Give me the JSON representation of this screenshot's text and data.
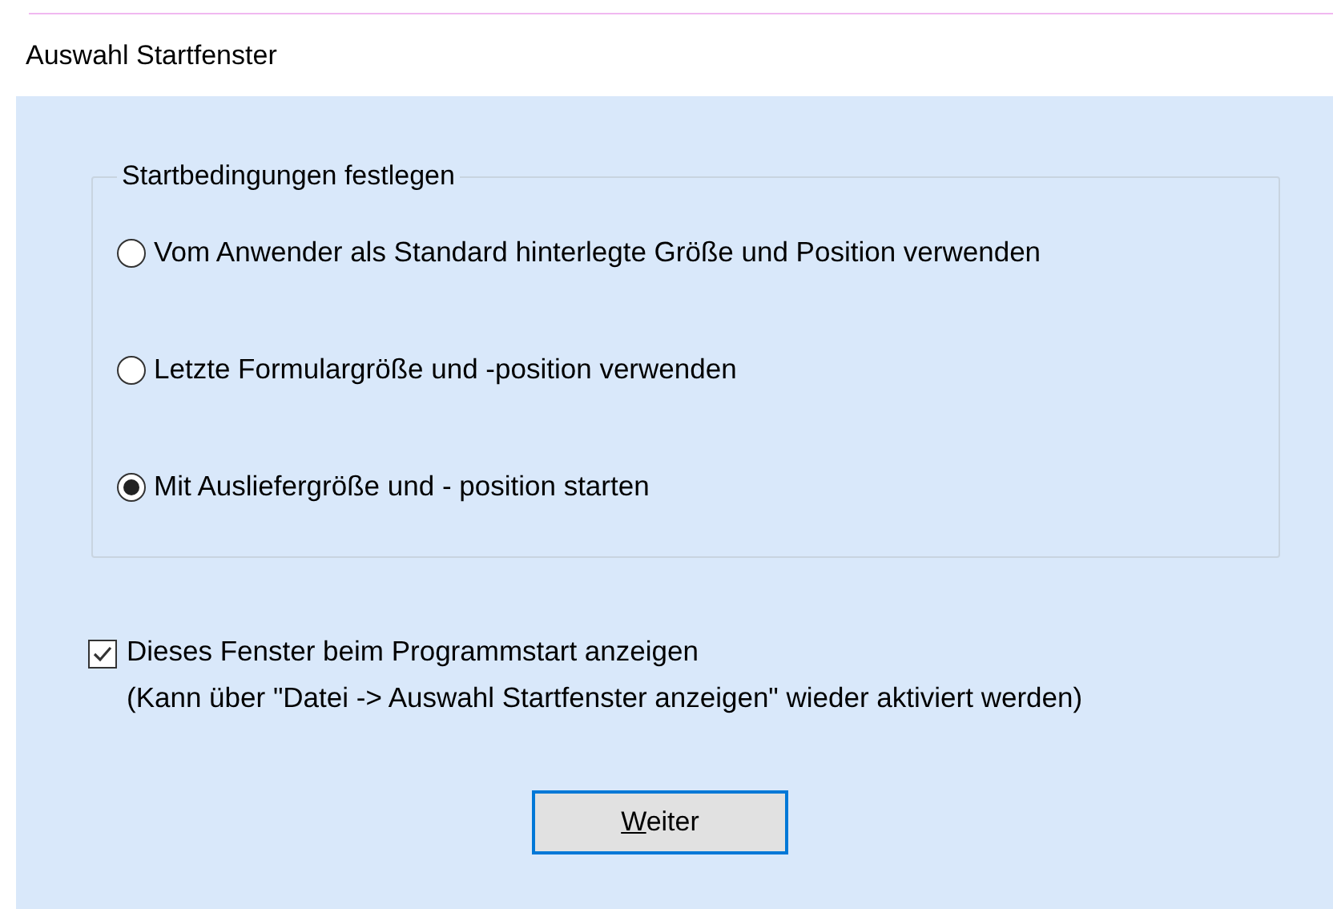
{
  "window": {
    "title": "Auswahl Startfenster"
  },
  "group": {
    "title": "Startbedingungen festlegen",
    "options": [
      {
        "label": "Vom Anwender als Standard hinterlegte Größe und Position verwenden",
        "selected": false
      },
      {
        "label": "Letzte Formulargröße und -position verwenden",
        "selected": false
      },
      {
        "label": "Mit Ausliefergröße und - position starten",
        "selected": true
      }
    ]
  },
  "checkbox": {
    "label": "Dieses Fenster beim Programmstart anzeigen",
    "hint": "(Kann über \"Datei -> Auswahl Startfenster anzeigen\" wieder aktiviert werden)",
    "checked": true
  },
  "button": {
    "label": "Weiter"
  }
}
